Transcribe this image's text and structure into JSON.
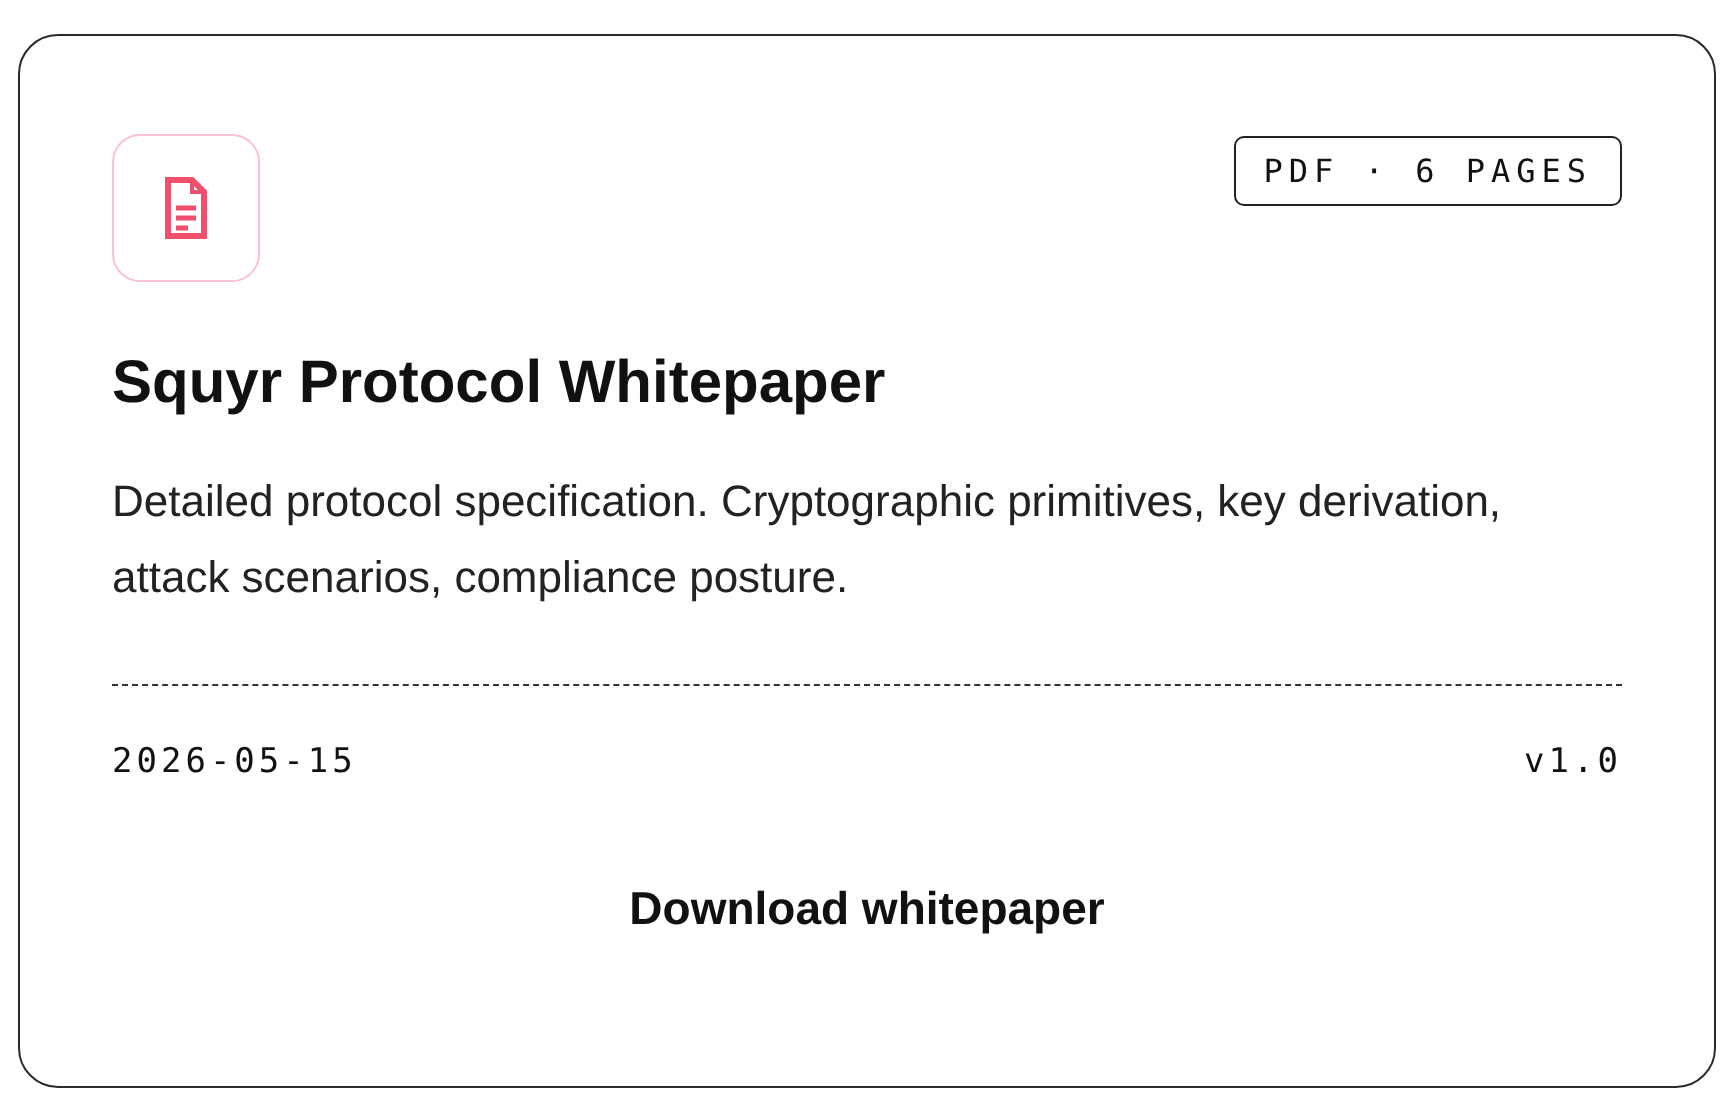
{
  "card": {
    "badge": "PDF · 6 PAGES",
    "title": "Squyr Protocol Whitepaper",
    "description": "Detailed protocol specification. Cryptographic primitives, key derivation, attack scenarios, compliance posture.",
    "date": "2026-05-15",
    "version": "v1.0",
    "button": "Download whitepaper"
  }
}
